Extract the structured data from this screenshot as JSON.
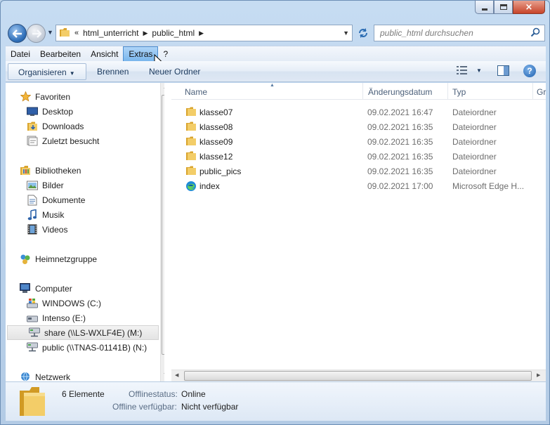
{
  "window": {
    "caption": {
      "min": "minimize",
      "max": "maximize",
      "close": "×"
    }
  },
  "nav": {
    "breadcrumb": [
      "html_unterricht",
      "public_html"
    ],
    "breadcrumb_prefix": "«",
    "search_placeholder": "public_html durchsuchen"
  },
  "menubar": {
    "items": [
      "Datei",
      "Bearbeiten",
      "Ansicht",
      "Extras",
      "?"
    ],
    "active": "Extras"
  },
  "toolbar": {
    "organize": "Organisieren",
    "rename": "Brennen",
    "new_folder": "Neuer Ordner"
  },
  "sidebar": {
    "favorites": "Favoriten",
    "favorites_items": [
      "Desktop",
      "Downloads",
      "Zuletzt besucht"
    ],
    "libraries": "Bibliotheken",
    "libraries_items": [
      "Bilder",
      "Dokumente",
      "Musik",
      "Videos"
    ],
    "homegroup": "Heimnetzgruppe",
    "computer": "Computer",
    "computer_items": [
      "WINDOWS (C:)",
      "Intenso (E:)",
      "share (\\\\LS-WXLF4E) (M:)",
      "public (\\\\TNAS-01141B) (N:)"
    ],
    "selected": "share (\\\\LS-WXLF4E) (M:)",
    "network": "Netzwerk"
  },
  "files": {
    "columns": [
      "Name",
      "Änderungsdatum",
      "Typ",
      "Gr"
    ],
    "rows": [
      {
        "name": "klasse07",
        "date": "09.02.2021 16:47",
        "type": "Dateiordner",
        "icon": "folder-icon"
      },
      {
        "name": "klasse08",
        "date": "09.02.2021 16:35",
        "type": "Dateiordner",
        "icon": "folder-icon"
      },
      {
        "name": "klasse09",
        "date": "09.02.2021 16:35",
        "type": "Dateiordner",
        "icon": "folder-icon"
      },
      {
        "name": "klasse12",
        "date": "09.02.2021 16:35",
        "type": "Dateiordner",
        "icon": "folder-icon"
      },
      {
        "name": "public_pics",
        "date": "09.02.2021 16:35",
        "type": "Dateiordner",
        "icon": "folder-icon"
      },
      {
        "name": "index",
        "date": "09.02.2021 17:00",
        "type": "Microsoft Edge H...",
        "icon": "edge-icon"
      }
    ]
  },
  "details": {
    "count": "6 Elemente",
    "offline_status_label": "Offlinestatus:",
    "offline_status_value": "Online",
    "offline_avail_label": "Offline verfügbar:",
    "offline_avail_value": "Nicht verfügbar"
  },
  "colors": {
    "accent": "#3a7bd5",
    "selection": "#79b6ec",
    "folder": "#e8b84a"
  }
}
